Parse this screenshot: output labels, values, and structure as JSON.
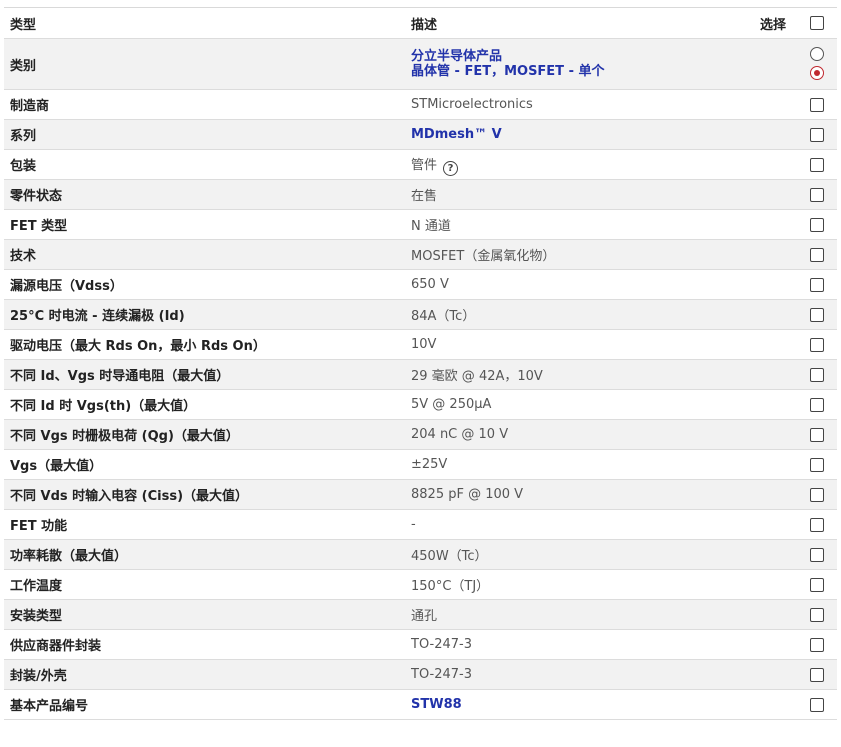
{
  "header": {
    "type": "类型",
    "desc": "描述",
    "select": "选择"
  },
  "category": {
    "label": "类别",
    "line1": "分立半导体产品",
    "line2": "晶体管 - FET，MOSFET - 单个"
  },
  "rows": [
    {
      "label": "制造商",
      "value": "STMicroelectronics",
      "link": false
    },
    {
      "label": "系列",
      "value": "MDmesh™ V",
      "link": true
    },
    {
      "label": "包装",
      "value": "管件",
      "link": false,
      "help": true
    },
    {
      "label": "零件状态",
      "value": "在售",
      "link": false
    },
    {
      "label": "FET 类型",
      "value": "N 通道",
      "link": false
    },
    {
      "label": "技术",
      "value": "MOSFET（金属氧化物）",
      "link": false
    },
    {
      "label": "漏源电压（Vdss）",
      "value": "650 V",
      "link": false
    },
    {
      "label": "25°C 时电流 - 连续漏极 (Id)",
      "value": "84A（Tc）",
      "link": false
    },
    {
      "label": "驱动电压（最大 Rds On，最小 Rds On）",
      "value": "10V",
      "link": false
    },
    {
      "label": "不同 Id、Vgs 时导通电阻（最大值）",
      "value": "29 毫欧 @ 42A，10V",
      "link": false
    },
    {
      "label": "不同 Id 时 Vgs(th)（最大值）",
      "value": "5V @ 250µA",
      "link": false
    },
    {
      "label": "不同 Vgs 时栅极电荷 (Qg)（最大值）",
      "value": "204 nC @ 10 V",
      "link": false
    },
    {
      "label": "Vgs（最大值）",
      "value": "±25V",
      "link": false
    },
    {
      "label": "不同 Vds 时输入电容 (Ciss)（最大值）",
      "value": "8825 pF @ 100 V",
      "link": false
    },
    {
      "label": "FET 功能",
      "value": "-",
      "link": false
    },
    {
      "label": "功率耗散（最大值）",
      "value": "450W（Tc）",
      "link": false
    },
    {
      "label": "工作温度",
      "value": "150°C（TJ）",
      "link": false
    },
    {
      "label": "安装类型",
      "value": "通孔",
      "link": false
    },
    {
      "label": "供应商器件封装",
      "value": "TO-247-3",
      "link": false
    },
    {
      "label": "封装/外壳",
      "value": "TO-247-3",
      "link": false
    },
    {
      "label": "基本产品编号",
      "value": "STW88",
      "link": true
    }
  ],
  "icons": {
    "help": "question-circle-icon",
    "checkbox": "checkbox-unchecked",
    "radio": "radio-button"
  },
  "colors": {
    "link": "#2233aa",
    "radio_selected": "#c0282f",
    "row_alt": "#f2f2f2"
  }
}
